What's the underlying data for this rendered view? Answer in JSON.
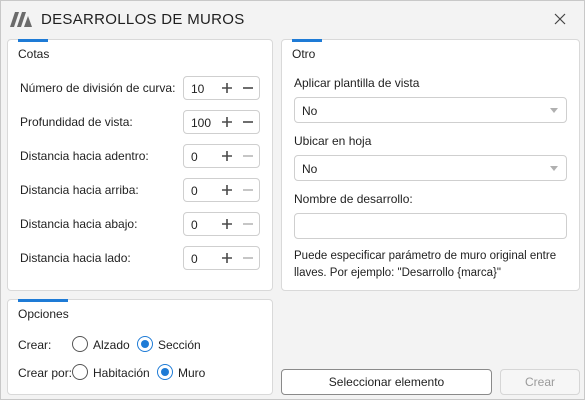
{
  "window": {
    "title": "DESARROLLOS DE MUROS"
  },
  "colors": {
    "accent": "#1e7bd6",
    "icon": "#4a4a4a",
    "icon_disabled": "#b8b8b8"
  },
  "cotas": {
    "title": "Cotas",
    "rows": [
      {
        "label": "Número de división de curva:",
        "value": "10",
        "minus_enabled": true
      },
      {
        "label": "Profundidad de vista:",
        "value": "100",
        "minus_enabled": true
      },
      {
        "label": "Distancia hacia adentro:",
        "value": "0",
        "minus_enabled": false
      },
      {
        "label": "Distancia hacia arriba:",
        "value": "0",
        "minus_enabled": false
      },
      {
        "label": "Distancia hacia abajo:",
        "value": "0",
        "minus_enabled": false
      },
      {
        "label": "Distancia hacia lado:",
        "value": "0",
        "minus_enabled": false
      }
    ]
  },
  "otro": {
    "title": "Otro",
    "plantilla_label": "Aplicar plantilla de vista",
    "plantilla_value": "No",
    "hoja_label": "Ubicar en hoja",
    "hoja_value": "No",
    "nombre_label": "Nombre de desarrollo:",
    "nombre_value": "",
    "help_text": "Puede especificar parámetro de muro original entre llaves. Por ejemplo: \"Desarrollo {marca}\""
  },
  "opciones": {
    "title": "Opciones",
    "crear_label": "Crear:",
    "crear_options": [
      {
        "label": "Alzado",
        "checked": false
      },
      {
        "label": "Sección",
        "checked": true
      }
    ],
    "crear_por_label": "Crear por:",
    "crear_por_options": [
      {
        "label": "Habitación",
        "checked": false
      },
      {
        "label": "Muro",
        "checked": true
      }
    ]
  },
  "buttons": {
    "select": "Seleccionar elemento",
    "create": "Crear"
  }
}
